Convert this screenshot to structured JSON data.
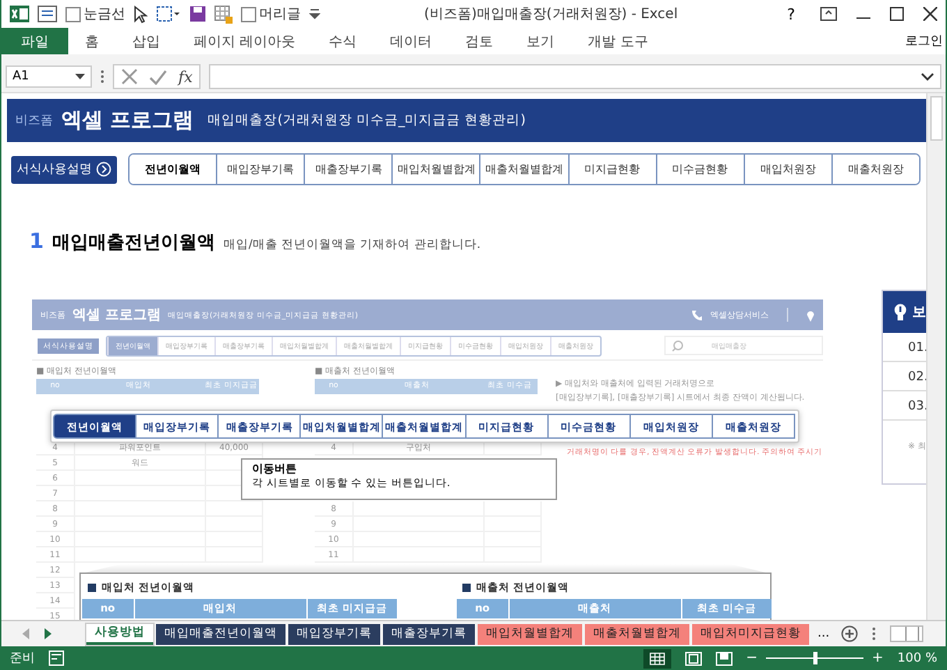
{
  "window": {
    "title": "(비즈폼)매입매출장(거래처원장) - Excel",
    "help": "?"
  },
  "quick_access": [
    {
      "label": "눈금선",
      "checked": false
    },
    {
      "label": "머리글",
      "checked": false
    }
  ],
  "ribbon_tabs": [
    {
      "label": "파일",
      "selected": true
    },
    {
      "label": "홈",
      "selected": false
    },
    {
      "label": "삽입",
      "selected": false
    },
    {
      "label": "페이지 레이아웃",
      "selected": false
    },
    {
      "label": "수식",
      "selected": false
    },
    {
      "label": "데이터",
      "selected": false
    },
    {
      "label": "검토",
      "selected": false
    },
    {
      "label": "보기",
      "selected": false
    },
    {
      "label": "개발 도구",
      "selected": false
    }
  ],
  "account": "로그인",
  "formula_bar": {
    "name_box": "A1",
    "fx": "fx"
  },
  "banner": {
    "brand": "비즈폼",
    "title": "엑셀 프로그램",
    "subtitle": "매입매출장(거래처원장 미수금_미지급금 현황관리)"
  },
  "guide_button": "서식사용설명",
  "nav_tabs": [
    {
      "label": "전년이월액",
      "selected": true
    },
    {
      "label": "매입장부기록",
      "selected": false
    },
    {
      "label": "매출장부기록",
      "selected": false
    },
    {
      "label": "매입처월별합계",
      "selected": false
    },
    {
      "label": "매출처월별합계",
      "selected": false
    },
    {
      "label": "미지급현황",
      "selected": false
    },
    {
      "label": "미수금현황",
      "selected": false
    },
    {
      "label": "매입처원장",
      "selected": false
    },
    {
      "label": "매출처원장",
      "selected": false
    }
  ],
  "section": {
    "number": "1",
    "title": "매입매출전년이월액",
    "description": "매입/매출 전년이월액을 기재하여 관리합니다."
  },
  "preview": {
    "brand": "비즈폼",
    "title": "엑셀 프로그램",
    "subtitle": "매입매출장(거래처원장 미수금_미지급금 현황관리)",
    "service": "엑셀상담서비스",
    "guide_button": "서식사용설명",
    "nav_tabs": [
      {
        "label": "전년이월액",
        "selected": true
      },
      {
        "label": "매입장부기록",
        "selected": false
      },
      {
        "label": "매출장부기록",
        "selected": false
      },
      {
        "label": "매입처월별합계",
        "selected": false
      },
      {
        "label": "매출처월별합계",
        "selected": false
      },
      {
        "label": "미지급현황",
        "selected": false
      },
      {
        "label": "미수금현황",
        "selected": false
      },
      {
        "label": "매입처원장",
        "selected": false
      },
      {
        "label": "매출처원장",
        "selected": false
      }
    ],
    "search_placeholder": "매입매출장",
    "tables": [
      {
        "title": "■ 매입처 전년이월액",
        "columns": [
          "no",
          "매입처",
          "최초 미지급금"
        ],
        "rows": [
          {
            "no": "4",
            "name": "파워포인트",
            "amount": "40,000"
          },
          {
            "no": "5",
            "name": "워드",
            "amount": ""
          },
          {
            "no": "6",
            "name": "",
            "amount": ""
          },
          {
            "no": "7",
            "name": "",
            "amount": ""
          },
          {
            "no": "8",
            "name": "",
            "amount": ""
          },
          {
            "no": "9",
            "name": "",
            "amount": ""
          },
          {
            "no": "10",
            "name": "",
            "amount": ""
          },
          {
            "no": "11",
            "name": "",
            "amount": ""
          },
          {
            "no": "12",
            "name": "",
            "amount": ""
          },
          {
            "no": "13",
            "name": "",
            "amount": ""
          },
          {
            "no": "14",
            "name": "",
            "amount": ""
          },
          {
            "no": "15",
            "name": "",
            "amount": ""
          }
        ]
      },
      {
        "title": "■ 매출처 전년이월액",
        "columns": [
          "no",
          "매출처",
          "최초 미수금"
        ],
        "rows": [
          {
            "no": "4",
            "name": "구입처",
            "amount": ""
          },
          {
            "no": "8",
            "name": "",
            "amount": ""
          },
          {
            "no": "9",
            "name": "",
            "amount": ""
          },
          {
            "no": "10",
            "name": "",
            "amount": ""
          },
          {
            "no": "11",
            "name": "",
            "amount": ""
          }
        ]
      }
    ],
    "notes": [
      "▶ 매입처와 매출처에 입력된 거래처명으로",
      "[매입장부기록], [매출장부기록] 시트에서 최종 잔액이 계산됩니다."
    ],
    "warning": "거래처명이 다를 경우, 잔액계산 오류가 발생합니다. 주의하여 주시기",
    "zoom_nav": [
      {
        "label": "전년이월액",
        "selected": true
      },
      {
        "label": "매입장부기록",
        "selected": false
      },
      {
        "label": "매출장부기록",
        "selected": false
      },
      {
        "label": "매입처월별합계",
        "selected": false
      },
      {
        "label": "매출처월별합계",
        "selected": false
      },
      {
        "label": "미지급현황",
        "selected": false
      },
      {
        "label": "미수금현황",
        "selected": false
      },
      {
        "label": "매입처원장",
        "selected": false
      },
      {
        "label": "매출처원장",
        "selected": false
      }
    ],
    "callout": {
      "title": "이동버튼",
      "text": "각 시트별로 이동할 수 있는 버튼입니다."
    },
    "zoom_tables": [
      {
        "title": "매입처 전년이월액",
        "columns": [
          "no",
          "매입처",
          "최초 미지급금"
        ]
      },
      {
        "title": "매출처 전년이월액",
        "columns": [
          "no",
          "매출처",
          "최초 미수금"
        ]
      }
    ]
  },
  "side_panel": {
    "title": "보",
    "items": [
      "01.",
      "02.",
      "03."
    ],
    "note": "※ 최"
  },
  "sheet_tabs": [
    {
      "label": "사용방법",
      "selected": true,
      "color": "#ffffff"
    },
    {
      "label": "매입매출전년이월액",
      "selected": false,
      "color": "#2b3d5f"
    },
    {
      "label": "매입장부기록",
      "selected": false,
      "color": "#2b3d5f"
    },
    {
      "label": "매출장부기록",
      "selected": false,
      "color": "#2b3d5f"
    },
    {
      "label": "매입처월별합계",
      "selected": false,
      "color": "#f4817b"
    },
    {
      "label": "매출처월별합계",
      "selected": false,
      "color": "#f4817b"
    },
    {
      "label": "매입처미지급현황",
      "selected": false,
      "color": "#f4817b"
    }
  ],
  "more_tabs": "...",
  "status": {
    "text": "준비",
    "zoom_out": "−",
    "zoom_in": "+",
    "zoom": "100 %",
    "level": 0.5
  }
}
